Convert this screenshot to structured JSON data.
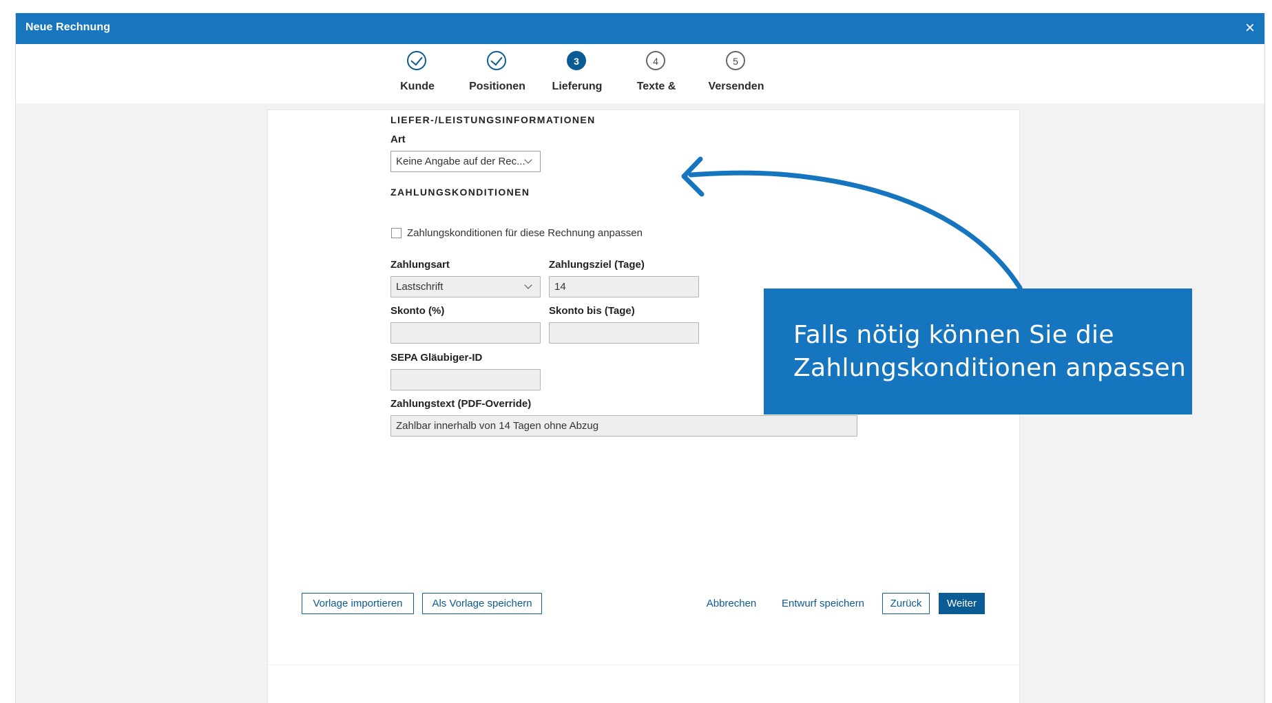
{
  "dialog": {
    "title": "Neue Rechnung",
    "close_label": "×"
  },
  "stepper": {
    "steps": [
      {
        "label": "Kunde",
        "state": "done",
        "number": ""
      },
      {
        "label": "Positionen",
        "state": "done",
        "number": ""
      },
      {
        "label": "Lieferung",
        "state": "active",
        "number": "3"
      },
      {
        "label": "Texte &",
        "state": "todo",
        "number": "4"
      },
      {
        "label": "Versenden",
        "state": "todo",
        "number": "5"
      }
    ]
  },
  "form": {
    "delivery": {
      "section_title": "LIEFER-/LEISTUNGSINFORMATIONEN",
      "art_label": "Art",
      "art_value": "Keine Angabe auf der Rec..."
    },
    "payment": {
      "section_title": "ZAHLUNGSKONDITIONEN",
      "customize_checkbox_label": "Zahlungskonditionen für diese Rechnung anpassen",
      "customize_checked": false,
      "zahlungsart_label": "Zahlungsart",
      "zahlungsart_value": "Lastschrift",
      "zahlungsziel_label": "Zahlungsziel (Tage)",
      "zahlungsziel_value": "14",
      "skonto_label": "Skonto (%)",
      "skonto_value": "",
      "skonto_bis_label": "Skonto bis (Tage)",
      "skonto_bis_value": "",
      "sepa_label": "SEPA Gläubiger-ID",
      "sepa_value": "",
      "zahlungstext_label": "Zahlungstext (PDF-Override)",
      "zahlungstext_value": "Zahlbar innerhalb von 14 Tagen ohne Abzug"
    }
  },
  "footer": {
    "import_template": "Vorlage importieren",
    "save_as_template": "Als Vorlage speichern",
    "cancel": "Abbrechen",
    "save_draft": "Entwurf speichern",
    "back": "Zurück",
    "next": "Weiter"
  },
  "callout": {
    "line1": "Falls nötig können Sie die",
    "line2": "Zahlungskonditionen anpassen"
  },
  "colors": {
    "header_blue": "#1776bd",
    "primary_blue": "#0b5b95",
    "callout_blue": "#1675bf",
    "step_todo_gray": "#666666"
  },
  "icons": {
    "close": "close-icon",
    "done_step": "checkmark-icon",
    "dropdown": "chevron-down-icon",
    "callout_arrow": "curved-arrow-icon"
  }
}
